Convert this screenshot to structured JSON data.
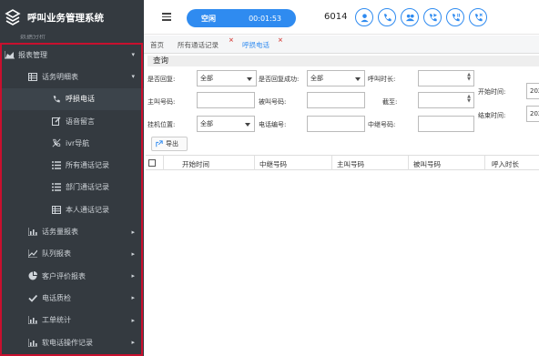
{
  "app": {
    "title": "呼叫业务管理系统"
  },
  "sidebar": {
    "cut_item": "数据分析",
    "items": [
      {
        "label": "报表管理",
        "icon": "chart-area-icon",
        "level": 0,
        "arrow": "▾"
      },
      {
        "label": "话务明细表",
        "icon": "table-icon",
        "level": 1,
        "arrow": "▾"
      },
      {
        "label": "呼损电话",
        "icon": "phone-icon",
        "level": 2,
        "active": true
      },
      {
        "label": "语音留言",
        "icon": "edit-icon",
        "level": 2
      },
      {
        "label": "ivr导航",
        "icon": "no-phone-icon",
        "level": 2
      },
      {
        "label": "所有通话记录",
        "icon": "list-icon",
        "level": 2
      },
      {
        "label": "部门通话记录",
        "icon": "list-icon",
        "level": 2
      },
      {
        "label": "本人通话记录",
        "icon": "table-icon",
        "level": 2
      },
      {
        "label": "话务量报表",
        "icon": "bar-chart-icon",
        "level": 1,
        "arrow": "▸"
      },
      {
        "label": "队列报表",
        "icon": "line-chart-icon",
        "level": 1,
        "arrow": "▸"
      },
      {
        "label": "客户评价报表",
        "icon": "pie-chart-icon",
        "level": 1,
        "arrow": "▸"
      },
      {
        "label": "电话质检",
        "icon": "check-icon",
        "level": 1,
        "arrow": "▸"
      },
      {
        "label": "工单统计",
        "icon": "bar-chart-icon",
        "level": 1,
        "arrow": "▸"
      },
      {
        "label": "软电话操作记录",
        "icon": "bar-chart-icon",
        "level": 1,
        "arrow": "▸"
      }
    ]
  },
  "topbar": {
    "status": "空闲",
    "timer": "00:01:53",
    "extension": "6014",
    "accent_color": "#2f8bf0"
  },
  "tabs": {
    "home": "首页",
    "all_records": "所有通话记录",
    "lost_calls": "呼损电话",
    "close_mark": "×"
  },
  "query": {
    "title": "查询",
    "labels": {
      "is_replied": "是否回复:",
      "reply_success": "是否回复成功:",
      "call_duration": "呼叫时长:",
      "start_time": "开始时间:",
      "caller": "主叫号码:",
      "callee": "被叫号码:",
      "to": "截至:",
      "end_time": "结束时间:",
      "hangup_position": "挂机位置:",
      "call_id": "电话编号:",
      "trunk_number": "中继号码:"
    },
    "values": {
      "is_replied": "全部",
      "reply_success": "全部",
      "hangup_position": "全部",
      "start_time": "202",
      "end_time": "202"
    },
    "spinner_up": "▲",
    "spinner_down": "▼"
  },
  "toolbar": {
    "export_label": "导出"
  },
  "table": {
    "columns": [
      "开始时间",
      "中继号码",
      "主叫号码",
      "被叫号码",
      "呼入时长"
    ]
  }
}
